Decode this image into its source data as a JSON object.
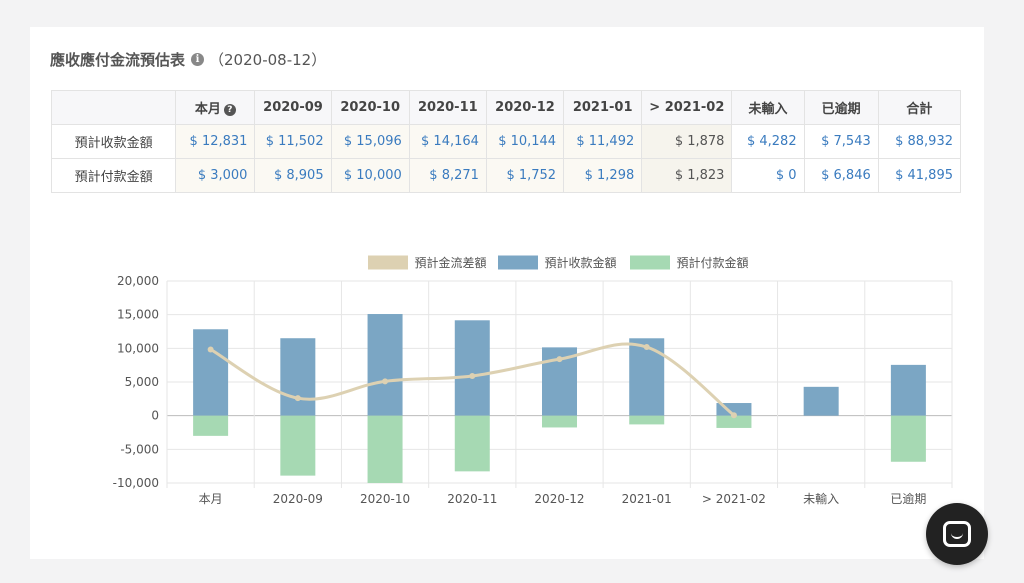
{
  "header": {
    "title": "應收應付金流預估表",
    "date": "（2020-08-12）"
  },
  "table": {
    "columns": [
      "本月",
      "2020-09",
      "2020-10",
      "2020-11",
      "2020-12",
      "2021-01",
      "> 2021-02",
      "未輸入",
      "已逾期",
      "合計"
    ],
    "rows": [
      {
        "label": "預計收款金額",
        "cells": [
          "$ 12,831",
          "$ 11,502",
          "$ 15,096",
          "$ 14,164",
          "$ 10,144",
          "$ 11,492",
          "$ 1,878",
          "$ 4,282",
          "$ 7,543",
          "$ 88,932"
        ]
      },
      {
        "label": "預計付款金額",
        "cells": [
          "$ 3,000",
          "$ 8,905",
          "$ 10,000",
          "$ 8,271",
          "$ 1,752",
          "$ 1,298",
          "$ 1,823",
          "$ 0",
          "$ 6,846",
          "$ 41,895"
        ]
      }
    ]
  },
  "chart_data": {
    "type": "bar",
    "categories": [
      "本月",
      "2020-09",
      "2020-10",
      "2020-11",
      "2020-12",
      "2021-01",
      "> 2021-02",
      "未輸入",
      "已逾期"
    ],
    "series": [
      {
        "name": "預計金流差額",
        "type": "line",
        "color": "#ddd1b2",
        "values": [
          9831,
          2597,
          5096,
          5893,
          8392,
          10194,
          55,
          null,
          null
        ]
      },
      {
        "name": "預計收款金額",
        "type": "bar",
        "color": "#7ba6c4",
        "values": [
          12831,
          11502,
          15096,
          14164,
          10144,
          11492,
          1878,
          4282,
          7543
        ]
      },
      {
        "name": "預計付款金額",
        "type": "bar",
        "color": "#a6d9b3",
        "values": [
          -3000,
          -8905,
          -10000,
          -8271,
          -1752,
          -1298,
          -1823,
          0,
          -6846
        ]
      }
    ],
    "ylim": [
      -10000,
      20000
    ],
    "yticks": [
      20000,
      15000,
      10000,
      5000,
      0,
      -5000,
      -10000
    ],
    "ytick_labels": [
      "20,000",
      "15,000",
      "10,000",
      "5,000",
      "0",
      "-5,000",
      "-10,000"
    ],
    "grid": true,
    "legend_position": "top-center"
  },
  "colors": {
    "link": "#3a7bbf",
    "income_bar": "#7ba6c4",
    "expense_bar": "#a6d9b3",
    "diff_line": "#ddd1b2"
  },
  "icons": {
    "info": "info-icon",
    "help": "question-circle-icon",
    "chat": "chat-bubble-icon"
  }
}
